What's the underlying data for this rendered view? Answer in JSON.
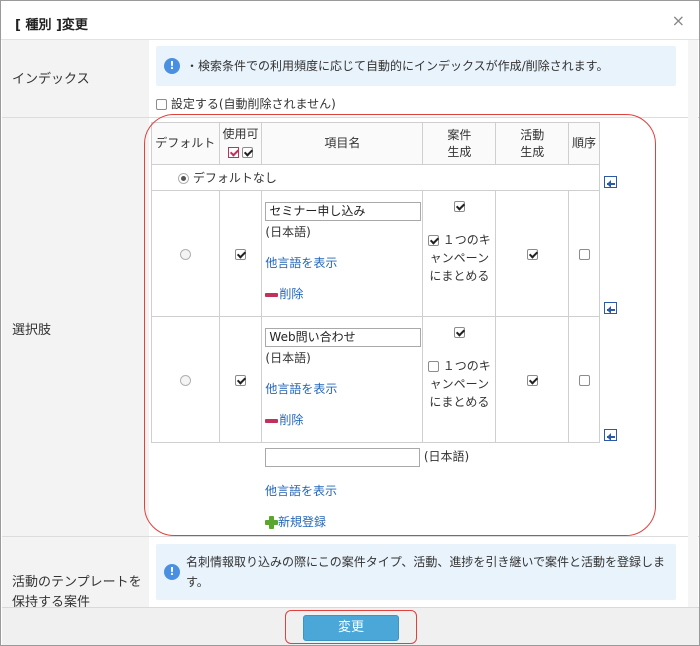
{
  "dialog": {
    "title": "[ 種別 ]変更",
    "close": "×"
  },
  "index_section": {
    "label": "インデックス",
    "info": "・検索条件での利用頻度に応じて自動的にインデックスが作成/削除されます。",
    "setting_label": "設定する(自動削除されません)",
    "setting_checked": false
  },
  "options_section": {
    "label": "選択肢",
    "headers": {
      "default": "デフォルト",
      "usable": "使用可",
      "name": "項目名",
      "case_create": "案件生成",
      "activity_create": "活動生成",
      "order": "順序"
    },
    "no_default": "デフォルトなし",
    "rows": [
      {
        "name": "セミナー申し込み",
        "lang": "(日本語)",
        "show_other_lang": "他言語を表示",
        "delete": "削除",
        "usable": true,
        "case_create": true,
        "campaign_checked": true,
        "campaign_label": "１つのキャンペーンにまとめる",
        "activity_create": true,
        "order": false
      },
      {
        "name": "Web問い合わせ",
        "lang": "(日本語)",
        "show_other_lang": "他言語を表示",
        "delete": "削除",
        "usable": true,
        "case_create": true,
        "campaign_checked": false,
        "campaign_label": "１つのキャンペーンにまとめる",
        "activity_create": true,
        "order": false
      }
    ],
    "new_entry": {
      "value": "",
      "lang": "(日本語)",
      "show_other_lang": "他言語を表示",
      "add": "新規登録"
    }
  },
  "template_section": {
    "label": "活動のテンプレートを保持する案件",
    "info": "名刺情報取り込みの際にこの案件タイプ、活動、進捗を引き継いで案件と活動を登録します。"
  },
  "footer": {
    "submit": "変更"
  },
  "colors": {
    "accent": "#4aa7d8",
    "highlight": "#e0413c",
    "link": "#2266bb"
  }
}
